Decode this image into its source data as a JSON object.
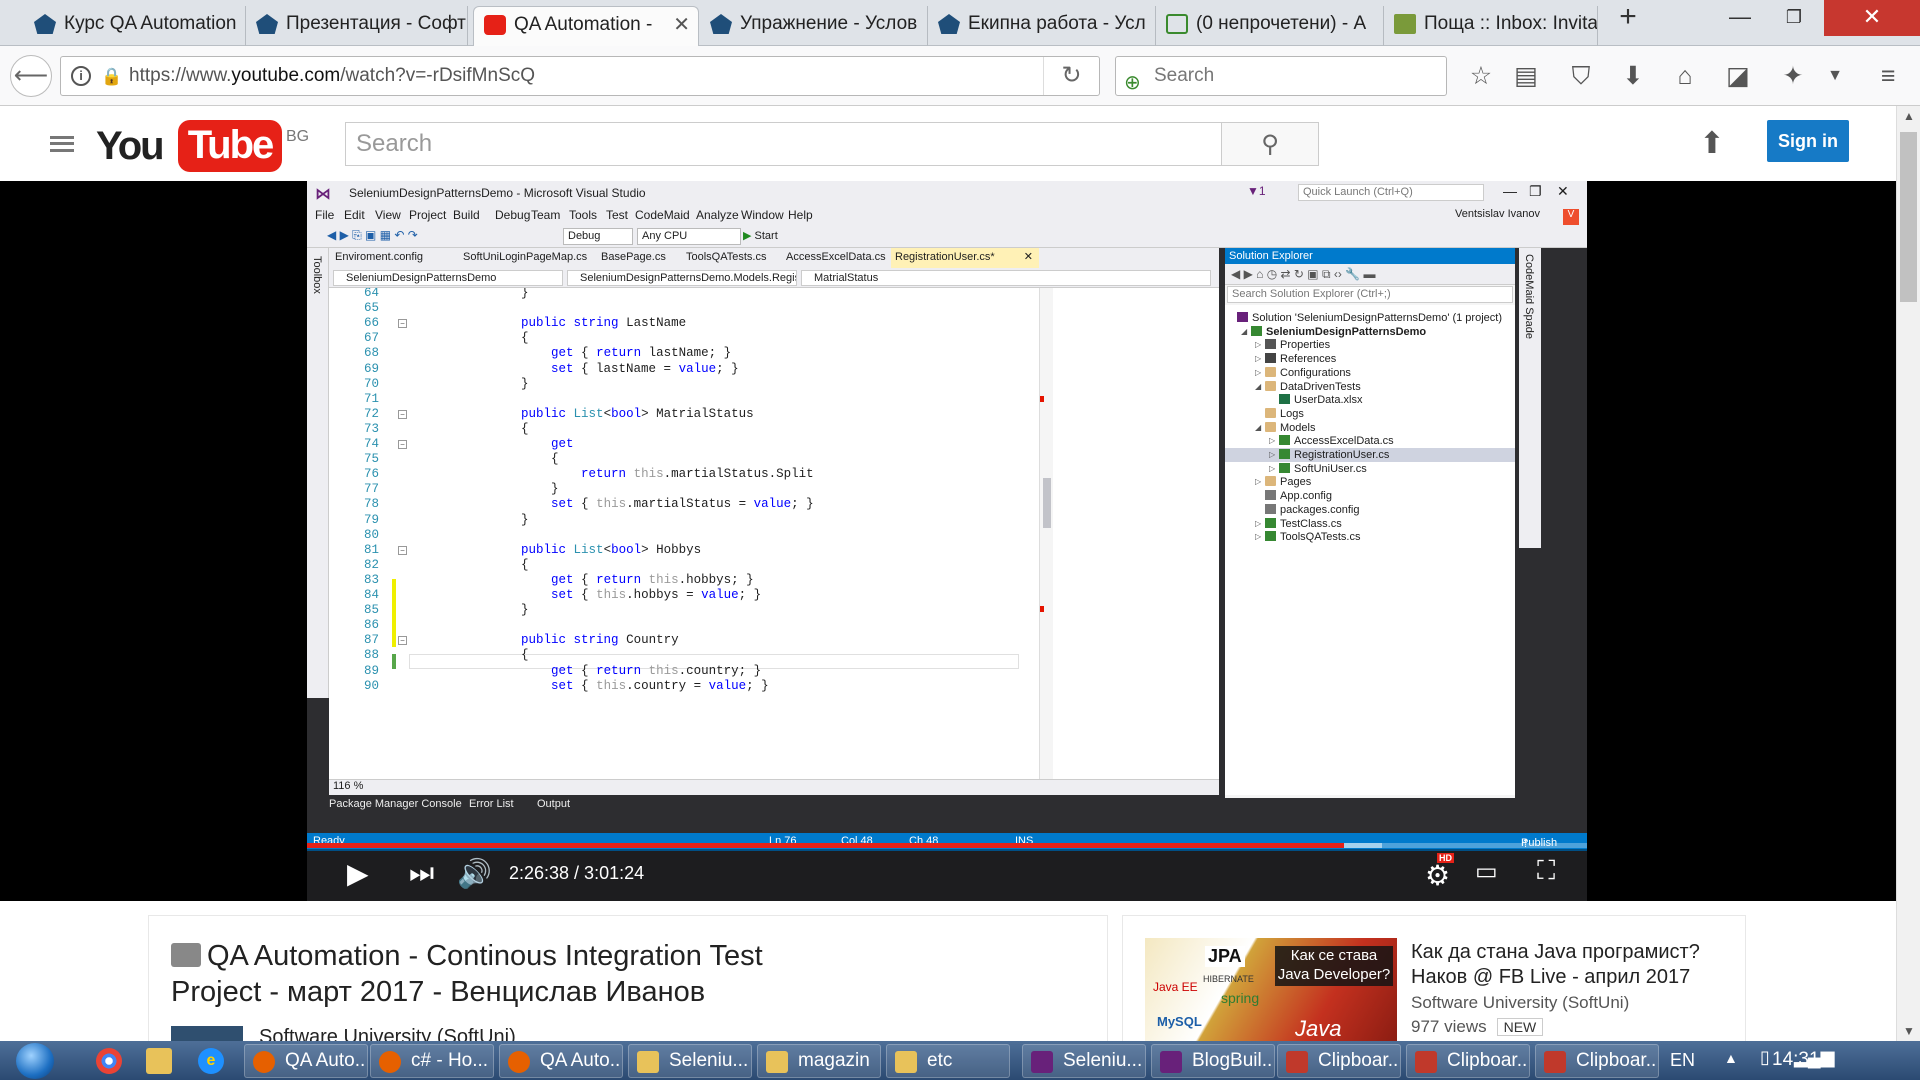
{
  "browser": {
    "tabs": [
      {
        "title": "Курс QA Automation"
      },
      {
        "title": "Презентация - Софт"
      },
      {
        "title": "QA Automation -",
        "active": true
      },
      {
        "title": "Упражнение - Услов"
      },
      {
        "title": "Екипна работа - Усл"
      },
      {
        "title": "(0 непрочетени) - A"
      },
      {
        "title": "Поща :: Inbox: Invita"
      }
    ],
    "new_tab": "+",
    "url_prefix": "https://www.",
    "url_domain": "youtube.com",
    "url_path": "/watch?v=-rDsifMnScQ",
    "search_placeholder": "Search"
  },
  "youtube": {
    "logo_you": "You",
    "logo_tube": "Tube",
    "country": "BG",
    "search_placeholder": "Search",
    "sign_in": "Sign in"
  },
  "vs": {
    "title": "SeleniumDesignPatternsDemo - Microsoft Visual Studio",
    "quick_launch": "Quick Launch (Ctrl+Q)",
    "user": "Ventsislav Ivanov",
    "menu": [
      "File",
      "Edit",
      "View",
      "Project",
      "Build",
      "Debug",
      "Team",
      "Tools",
      "Test",
      "CodeMaid",
      "Analyze",
      "Window",
      "Help"
    ],
    "config": "Debug",
    "platform": "Any CPU",
    "start": "Start",
    "toolbox": "Toolbox",
    "codemaid": "CodeMaid Spade",
    "tabs": [
      "Enviroment.config",
      "SoftUniLoginPageMap.cs",
      "BasePage.cs",
      "ToolsQATests.cs",
      "AccessExcelData.cs",
      "RegistrationUser.cs*"
    ],
    "nav": [
      "SeleniumDesignPatternsDemo",
      "SeleniumDesignPatternsDemo.Models.Registration",
      "MatrialStatus"
    ],
    "lines": [
      {
        "n": "64",
        "code": "            }"
      },
      {
        "n": "65",
        "code": ""
      },
      {
        "n": "66",
        "code": "            public string LastName"
      },
      {
        "n": "67",
        "code": "            {"
      },
      {
        "n": "68",
        "code": "                get { return lastName; }"
      },
      {
        "n": "69",
        "code": "                set { lastName = value; }"
      },
      {
        "n": "70",
        "code": "            }"
      },
      {
        "n": "71",
        "code": ""
      },
      {
        "n": "72",
        "code": "            public List<bool> MatrialStatus"
      },
      {
        "n": "73",
        "code": "            {"
      },
      {
        "n": "74",
        "code": "                get"
      },
      {
        "n": "75",
        "code": "                {"
      },
      {
        "n": "76",
        "code": "                    return this.martialStatus.Split"
      },
      {
        "n": "77",
        "code": "                }"
      },
      {
        "n": "78",
        "code": "                set { this.martialStatus = value; }"
      },
      {
        "n": "79",
        "code": "            }"
      },
      {
        "n": "80",
        "code": ""
      },
      {
        "n": "81",
        "code": "            public List<bool> Hobbys"
      },
      {
        "n": "82",
        "code": "            {"
      },
      {
        "n": "83",
        "code": "                get { return this.hobbys; }"
      },
      {
        "n": "84",
        "code": "                set { this.hobbys = value; }"
      },
      {
        "n": "85",
        "code": "            }"
      },
      {
        "n": "86",
        "code": ""
      },
      {
        "n": "87",
        "code": "            public string Country"
      },
      {
        "n": "88",
        "code": "            {"
      },
      {
        "n": "89",
        "code": "                get { return this.country; }"
      },
      {
        "n": "90",
        "code": "                set { this.country = value; }"
      }
    ],
    "zoom": "116 %",
    "solution_explorer": {
      "title": "Solution Explorer",
      "search": "Search Solution Explorer (Ctrl+;)",
      "items": [
        {
          "label": "Solution 'SeleniumDesignPatternsDemo' (1 project)",
          "depth": 0,
          "icon": "solution-icon",
          "tri": ""
        },
        {
          "label": "SeleniumDesignPatternsDemo",
          "depth": 1,
          "icon": "csproject-icon",
          "tri": "◢",
          "bold": true
        },
        {
          "label": "Properties",
          "depth": 2,
          "icon": "wrench-icon",
          "tri": "▷"
        },
        {
          "label": "References",
          "depth": 2,
          "icon": "references-icon",
          "tri": "▷"
        },
        {
          "label": "Configurations",
          "depth": 2,
          "icon": "folder-icon",
          "tri": "▷"
        },
        {
          "label": "DataDrivenTests",
          "depth": 2,
          "icon": "folder-icon",
          "tri": "◢"
        },
        {
          "label": "UserData.xlsx",
          "depth": 3,
          "icon": "excel-file-icon",
          "tri": ""
        },
        {
          "label": "Logs",
          "depth": 2,
          "icon": "folder-icon",
          "tri": ""
        },
        {
          "label": "Models",
          "depth": 2,
          "icon": "folder-icon",
          "tri": "◢"
        },
        {
          "label": "AccessExcelData.cs",
          "depth": 3,
          "icon": "csharp-file-icon",
          "tri": "▷"
        },
        {
          "label": "RegistrationUser.cs",
          "depth": 3,
          "icon": "csharp-file-icon",
          "tri": "▷",
          "selected": true
        },
        {
          "label": "SoftUniUser.cs",
          "depth": 3,
          "icon": "csharp-file-icon",
          "tri": "▷"
        },
        {
          "label": "Pages",
          "depth": 2,
          "icon": "folder-icon",
          "tri": "▷"
        },
        {
          "label": "App.config",
          "depth": 2,
          "icon": "config-file-icon",
          "tri": ""
        },
        {
          "label": "packages.config",
          "depth": 2,
          "icon": "config-file-icon",
          "tri": ""
        },
        {
          "label": "TestClass.cs",
          "depth": 2,
          "icon": "csharp-file-icon",
          "tri": "▷"
        },
        {
          "label": "ToolsQATests.cs",
          "depth": 2,
          "icon": "csharp-file-icon",
          "tri": "▷"
        }
      ]
    },
    "bottom_tabs": [
      "Package Manager Console",
      "Error List",
      "Output"
    ],
    "status": {
      "ready": "Ready",
      "ln": "Ln 76",
      "col": "Col 48",
      "ch": "Ch 48",
      "ins": "INS",
      "publish": "Publish"
    }
  },
  "player": {
    "time": "2:26:38 / 3:01:24",
    "played_fraction": 0.81,
    "buffered_fraction": 0.84,
    "hd": "HD"
  },
  "video": {
    "title": "QA Automation - Continous Integration Test Project - март 2017 - Венцислав Иванов",
    "channel": "Software University (SoftUni)"
  },
  "related": {
    "title": "Как да стана Java програмист? Наков @ FB Live - април 2017",
    "channel": "Software University (SoftUni)",
    "views": "977 views",
    "badge": "NEW",
    "thumb_caption": "Как се става Java Developer?",
    "thumb_words": [
      "JPA",
      "Java EE",
      "spring",
      "MySQL",
      "HIBERNATE",
      "Java"
    ]
  },
  "taskbar": {
    "buttons": [
      {
        "label": "QA Auto...",
        "icon": "firefox-icon"
      },
      {
        "label": "c# - Ho...",
        "icon": "firefox-icon"
      },
      {
        "label": "QA Auto...",
        "icon": "firefox-icon"
      },
      {
        "label": "Seleniu...",
        "icon": "folder-icon"
      },
      {
        "label": "magazin",
        "icon": "folder-icon"
      },
      {
        "label": "etc",
        "icon": "folder-icon"
      },
      {
        "label": "Seleniu...",
        "icon": "visual-studio-icon"
      },
      {
        "label": "BlogBuil...",
        "icon": "visual-studio-icon"
      },
      {
        "label": "Clipboar...",
        "icon": "clipboard-icon"
      },
      {
        "label": "Clipboar...",
        "icon": "clipboard-icon"
      },
      {
        "label": "Clipboar...",
        "icon": "clipboard-icon"
      }
    ],
    "lang": "EN",
    "time": "14:31"
  },
  "colors": {
    "youtube_red": "#e62117",
    "vs_blue": "#007acc",
    "signin_blue": "#167ac6"
  }
}
